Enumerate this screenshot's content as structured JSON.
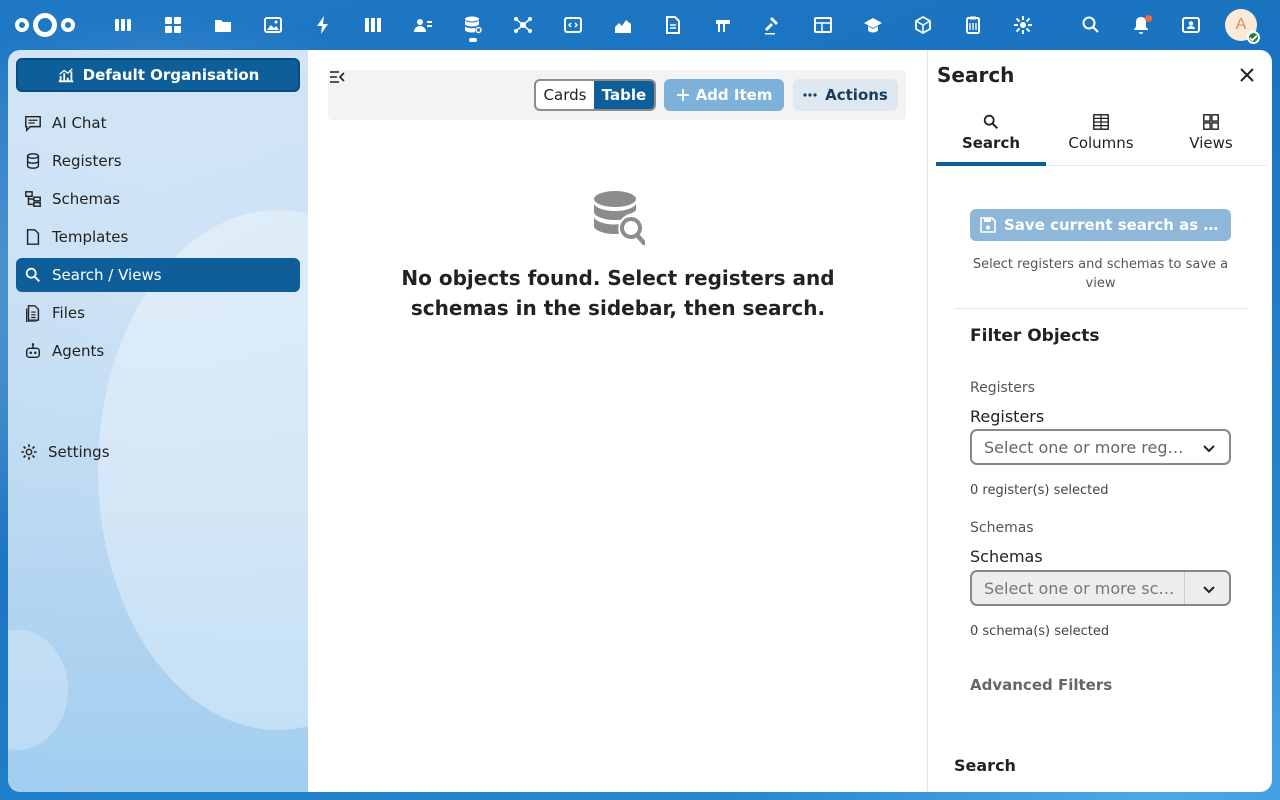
{
  "header": {
    "apps": [
      "dashboard-icon",
      "widgets-icon",
      "files-icon",
      "photos-icon",
      "activity-icon",
      "deck-icon",
      "contacts-icon",
      "openregister-icon",
      "network-icon",
      "code-icon",
      "analytics-icon",
      "document-icon",
      "flag-icon",
      "gavel-icon",
      "table-icon",
      "education-icon",
      "cube-icon",
      "clipboard-icon",
      "settings-app-icon"
    ],
    "avatar_letter": "A"
  },
  "sidebar": {
    "org_button": "Default Organisation",
    "items": [
      {
        "label": "AI Chat",
        "icon": "chat-icon"
      },
      {
        "label": "Registers",
        "icon": "database-icon"
      },
      {
        "label": "Schemas",
        "icon": "schema-icon"
      },
      {
        "label": "Templates",
        "icon": "file-icon"
      },
      {
        "label": "Search / Views",
        "icon": "search-icon",
        "active": true
      },
      {
        "label": "Files",
        "icon": "files-icon"
      },
      {
        "label": "Agents",
        "icon": "robot-icon"
      }
    ],
    "settings_label": "Settings"
  },
  "main": {
    "view_cards": "Cards",
    "view_table": "Table",
    "add_item": "Add Item",
    "actions": "Actions",
    "empty_message": "No objects found. Select registers and schemas in the sidebar, then search."
  },
  "panel": {
    "title": "Search",
    "tabs": [
      {
        "label": "Search",
        "icon": "search-icon",
        "active": true
      },
      {
        "label": "Columns",
        "icon": "columns-icon"
      },
      {
        "label": "Views",
        "icon": "views-icon"
      }
    ],
    "save_button": "Save current search as view",
    "save_hint": "Select registers and schemas to save a view",
    "filter_title": "Filter Objects",
    "registers_section": "Registers",
    "registers_label": "Registers",
    "registers_placeholder": "Select one or more registers",
    "registers_count": "0 register(s) selected",
    "schemas_section": "Schemas",
    "schemas_label": "Schemas",
    "schemas_placeholder": "Select one or more schemas",
    "schemas_count": "0 schema(s) selected",
    "advanced_filters": "Advanced Filters",
    "search_footer": "Search"
  },
  "colors": {
    "primary": "#0e5e9a",
    "header_bg": "#1f78c4",
    "notification": "#e9703e",
    "status_online": "#2d7b41"
  }
}
